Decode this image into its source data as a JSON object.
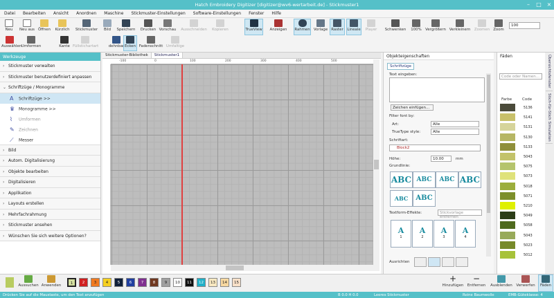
{
  "window": {
    "title": "Hatch Embroidery Digitizer [digitizer@wv6-wertarbeit.de] - Stickmuster1"
  },
  "menu": [
    "Datei",
    "Bearbeiten",
    "Ansicht",
    "Anordnen",
    "Maschine",
    "Stickmuster-Einstellungen",
    "Software-Einstellungen",
    "Fenster",
    "Hilfe"
  ],
  "toolbar": {
    "row1": [
      "Neu",
      "Neu aus",
      "Öffnen",
      "Kürzlich",
      "Stickmuster",
      "Bild",
      "Speichern",
      "Drucken",
      "Vorschau",
      "Ausschneiden",
      "Kopieren",
      "TrueView",
      "Anzeigen",
      "Rahmen",
      "Vorlage",
      "Raster",
      "Lineale",
      "Player",
      "Schwenken",
      "100%",
      "Vergrößern",
      "Verkleinern",
      "Zoomen",
      "Zoom"
    ],
    "row2": [
      "Auswählen",
      "Umformen",
      "Kante",
      "Füllstichartart",
      "dehnbar",
      "Ecken",
      "Fadenschnitt",
      "Umfaltige"
    ],
    "zoom": "100"
  },
  "left": {
    "header": "Werkzeuge",
    "items": [
      "Stickmuster verwalten",
      "Stickmuster benutzerdefiniert anpassen",
      "Schriftzüge / Monogramme"
    ],
    "sub": [
      "Schriftzüge >>",
      "Monogramme >>",
      "Umformen",
      "Zeichnen",
      "Messer"
    ],
    "items2": [
      "Bild",
      "Autom. Digitalisierung",
      "Objekte bearbeiten",
      "Digitalisieren",
      "Applikation",
      "Layouts erstellen",
      "Mehrfachrahmung",
      "Stickmuster ansehen",
      "Wünschen Sie sich weitere Optionen?"
    ]
  },
  "canvas": {
    "tabs": [
      "Stickmuster-Bibliothek",
      "Stickmuster1"
    ],
    "ticks": [
      "-100",
      "0",
      "100",
      "200",
      "300",
      "400",
      "500"
    ]
  },
  "props": {
    "header": "Objekteigenschaften",
    "tab": "Schriftzüge",
    "text_label": "Text eingeben:",
    "insert": "Zeichen einfügen...",
    "filter": "Filter font by:",
    "art_label": "Art:",
    "art_val": "Alle",
    "tt_label": "TrueType style:",
    "tt_val": "Alle",
    "font_label": "Schriftart:",
    "font_val": "Block2",
    "height_label": "Höhe:",
    "height_val": "10.00",
    "height_unit": "mm",
    "base_label": "Grundlinie:",
    "effects_label": "Textform-Effekte:",
    "remove": "Stickvorlage entfernen",
    "align_label": "Ausrichten",
    "tiles": [
      "ABC",
      "ABC",
      "ABC",
      "ABC",
      "ABC",
      "ABC"
    ],
    "swatches": [
      "1",
      "2",
      "3",
      "4"
    ]
  },
  "threads": {
    "header": "Fäden",
    "search": "Code oder Namen...",
    "col1": "Farbe",
    "col2": "Code",
    "rows": [
      [
        "#4a4a3a",
        "5136"
      ],
      [
        "#c8c06a",
        "5141"
      ],
      [
        "#d6d49a",
        "5131"
      ],
      [
        "#b6b664",
        "5130"
      ],
      [
        "#8f8f3a",
        "5133"
      ],
      [
        "#c3c36a",
        "5043"
      ],
      [
        "#b5c46c",
        "5075"
      ],
      [
        "#dfe27a",
        "5073"
      ],
      [
        "#9cae3c",
        "5018"
      ],
      [
        "#7d8f2a",
        "5071"
      ],
      [
        "#dff000",
        "5210"
      ],
      [
        "#2c3d18",
        "5049"
      ],
      [
        "#4f6a1e",
        "5058"
      ],
      [
        "#98aa5a",
        "5043"
      ],
      [
        "#778a2a",
        "5023"
      ],
      [
        "#a7c23a",
        "5012"
      ]
    ]
  },
  "sidetabs": [
    "Übersichtsfenster",
    "Stich-für-Stich Simulation"
  ],
  "colors": [
    [
      "1",
      "#d4e0a0"
    ],
    [
      "2",
      "#d02020"
    ],
    [
      "3",
      "#f07a20"
    ],
    [
      "4",
      "#f5d020"
    ],
    [
      "5",
      "#10203a"
    ],
    [
      "6",
      "#2040a0"
    ],
    [
      "7",
      "#803090"
    ],
    [
      "8",
      "#703820"
    ],
    [
      "9",
      "#a0a0a0"
    ],
    [
      "10",
      "#ffffff"
    ],
    [
      "11",
      "#101010"
    ],
    [
      "12",
      "#20b0c8"
    ],
    [
      "13",
      "#f8e8c0"
    ],
    [
      "14",
      "#f8d8a0"
    ],
    [
      "15",
      "#f8e0c8"
    ]
  ],
  "bottom": {
    "aussuchen": "Aussuchen",
    "anwenden": "Anwenden",
    "hinzufuegen": "Hinzufügen",
    "entfernen": "Entfernen",
    "ausblenden": "Ausblenden",
    "verwerfen": "Verwerfen",
    "faeden": "Fäden"
  },
  "status": {
    "hint": "Drücken Sie auf die Maustaste, um den Text anzufügen",
    "coords": "B 0.0 H 0.0",
    "fabric": "Leeres Stickmuster",
    "thread": "Reine Baumwolle",
    "hoop": "EMB-Güteklasse: 4"
  }
}
